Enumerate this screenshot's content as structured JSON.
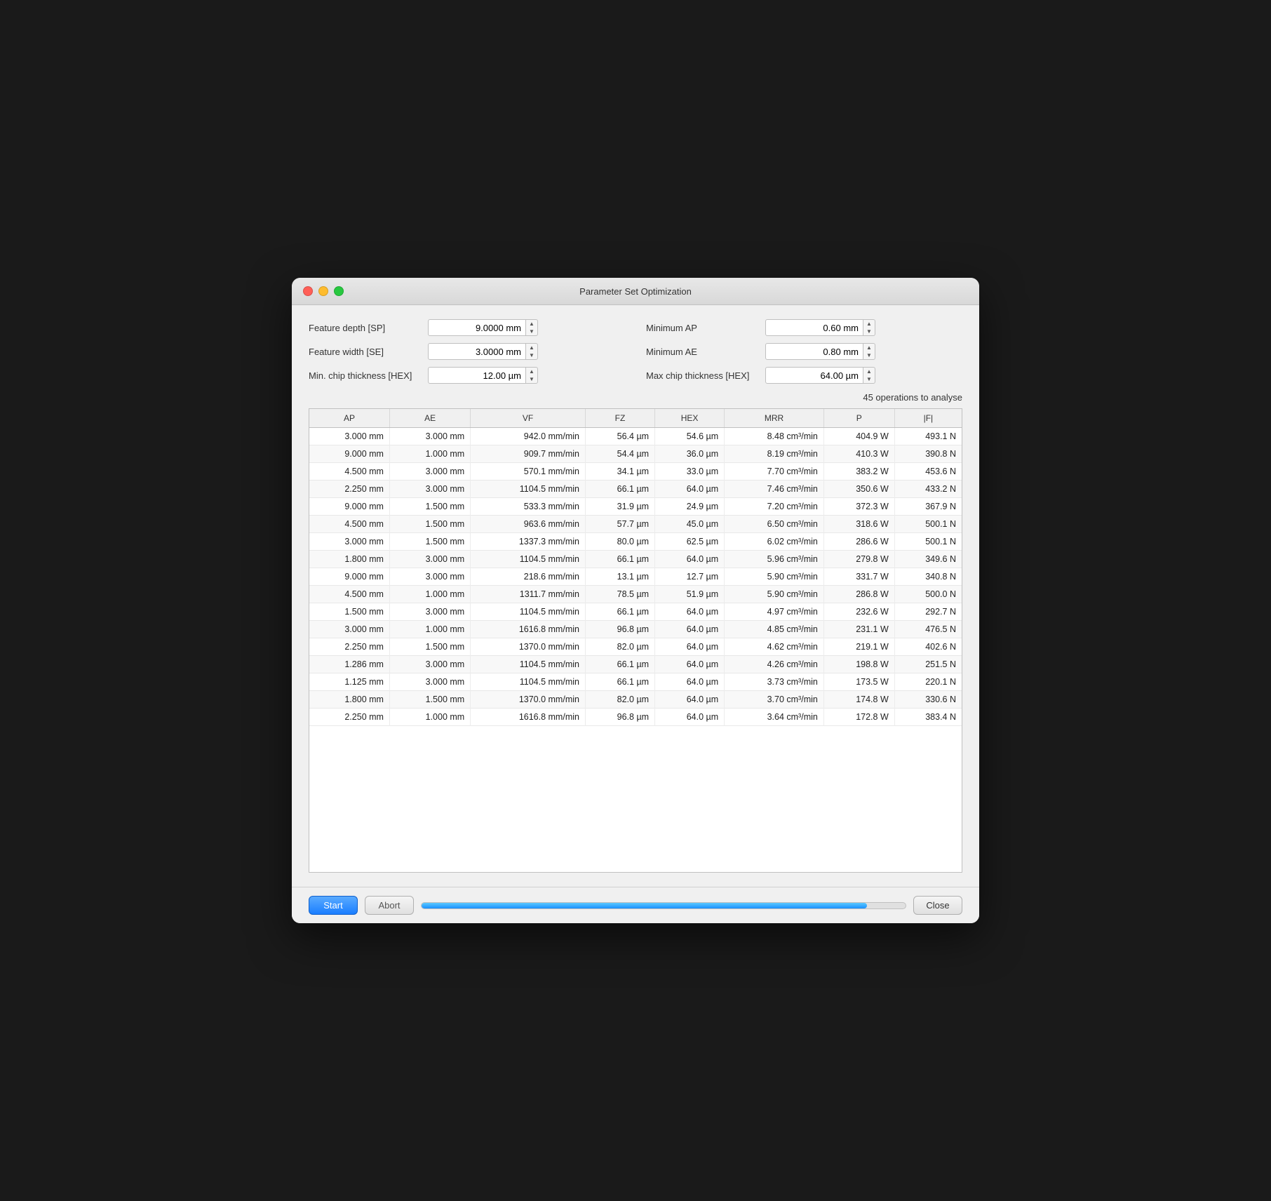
{
  "window": {
    "title": "Parameter Set Optimization"
  },
  "form": {
    "feature_depth_label": "Feature depth [SP]",
    "feature_depth_value": "9.0000 mm",
    "feature_width_label": "Feature width [SE]",
    "feature_width_value": "3.0000 mm",
    "min_chip_thickness_label": "Min. chip thickness [HEX]",
    "min_chip_thickness_value": "12.00 µm",
    "minimum_ap_label": "Minimum AP",
    "minimum_ap_value": "0.60 mm",
    "minimum_ae_label": "Minimum AE",
    "minimum_ae_value": "0.80 mm",
    "max_chip_thickness_label": "Max chip thickness [HEX]",
    "max_chip_thickness_value": "64.00 µm"
  },
  "operations_count": "45 operations to analyse",
  "table": {
    "headers": [
      "AP",
      "AE",
      "VF",
      "FZ",
      "HEX",
      "MRR",
      "P",
      "|F|"
    ],
    "rows": [
      [
        "3.000 mm",
        "3.000 mm",
        "942.0 mm/min",
        "56.4 µm",
        "54.6 µm",
        "8.48 cm³/min",
        "404.9 W",
        "493.1 N"
      ],
      [
        "9.000 mm",
        "1.000 mm",
        "909.7 mm/min",
        "54.4 µm",
        "36.0 µm",
        "8.19 cm³/min",
        "410.3 W",
        "390.8 N"
      ],
      [
        "4.500 mm",
        "3.000 mm",
        "570.1 mm/min",
        "34.1 µm",
        "33.0 µm",
        "7.70 cm³/min",
        "383.2 W",
        "453.6 N"
      ],
      [
        "2.250 mm",
        "3.000 mm",
        "1104.5 mm/min",
        "66.1 µm",
        "64.0 µm",
        "7.46 cm³/min",
        "350.6 W",
        "433.2 N"
      ],
      [
        "9.000 mm",
        "1.500 mm",
        "533.3 mm/min",
        "31.9 µm",
        "24.9 µm",
        "7.20 cm³/min",
        "372.3 W",
        "367.9 N"
      ],
      [
        "4.500 mm",
        "1.500 mm",
        "963.6 mm/min",
        "57.7 µm",
        "45.0 µm",
        "6.50 cm³/min",
        "318.6 W",
        "500.1 N"
      ],
      [
        "3.000 mm",
        "1.500 mm",
        "1337.3 mm/min",
        "80.0 µm",
        "62.5 µm",
        "6.02 cm³/min",
        "286.6 W",
        "500.1 N"
      ],
      [
        "1.800 mm",
        "3.000 mm",
        "1104.5 mm/min",
        "66.1 µm",
        "64.0 µm",
        "5.96 cm³/min",
        "279.8 W",
        "349.6 N"
      ],
      [
        "9.000 mm",
        "3.000 mm",
        "218.6 mm/min",
        "13.1 µm",
        "12.7 µm",
        "5.90 cm³/min",
        "331.7 W",
        "340.8 N"
      ],
      [
        "4.500 mm",
        "1.000 mm",
        "1311.7 mm/min",
        "78.5 µm",
        "51.9 µm",
        "5.90 cm³/min",
        "286.8 W",
        "500.0 N"
      ],
      [
        "1.500 mm",
        "3.000 mm",
        "1104.5 mm/min",
        "66.1 µm",
        "64.0 µm",
        "4.97 cm³/min",
        "232.6 W",
        "292.7 N"
      ],
      [
        "3.000 mm",
        "1.000 mm",
        "1616.8 mm/min",
        "96.8 µm",
        "64.0 µm",
        "4.85 cm³/min",
        "231.1 W",
        "476.5 N"
      ],
      [
        "2.250 mm",
        "1.500 mm",
        "1370.0 mm/min",
        "82.0 µm",
        "64.0 µm",
        "4.62 cm³/min",
        "219.1 W",
        "402.6 N"
      ],
      [
        "1.286 mm",
        "3.000 mm",
        "1104.5 mm/min",
        "66.1 µm",
        "64.0 µm",
        "4.26 cm³/min",
        "198.8 W",
        "251.5 N"
      ],
      [
        "1.125 mm",
        "3.000 mm",
        "1104.5 mm/min",
        "66.1 µm",
        "64.0 µm",
        "3.73 cm³/min",
        "173.5 W",
        "220.1 N"
      ],
      [
        "1.800 mm",
        "1.500 mm",
        "1370.0 mm/min",
        "82.0 µm",
        "64.0 µm",
        "3.70 cm³/min",
        "174.8 W",
        "330.6 N"
      ],
      [
        "2.250 mm",
        "1.000 mm",
        "1616.8 mm/min",
        "96.8 µm",
        "64.0 µm",
        "3.64 cm³/min",
        "172.8 W",
        "383.4 N"
      ]
    ]
  },
  "footer": {
    "start_label": "Start",
    "abort_label": "Abort",
    "close_label": "Close",
    "progress_percent": 92
  }
}
